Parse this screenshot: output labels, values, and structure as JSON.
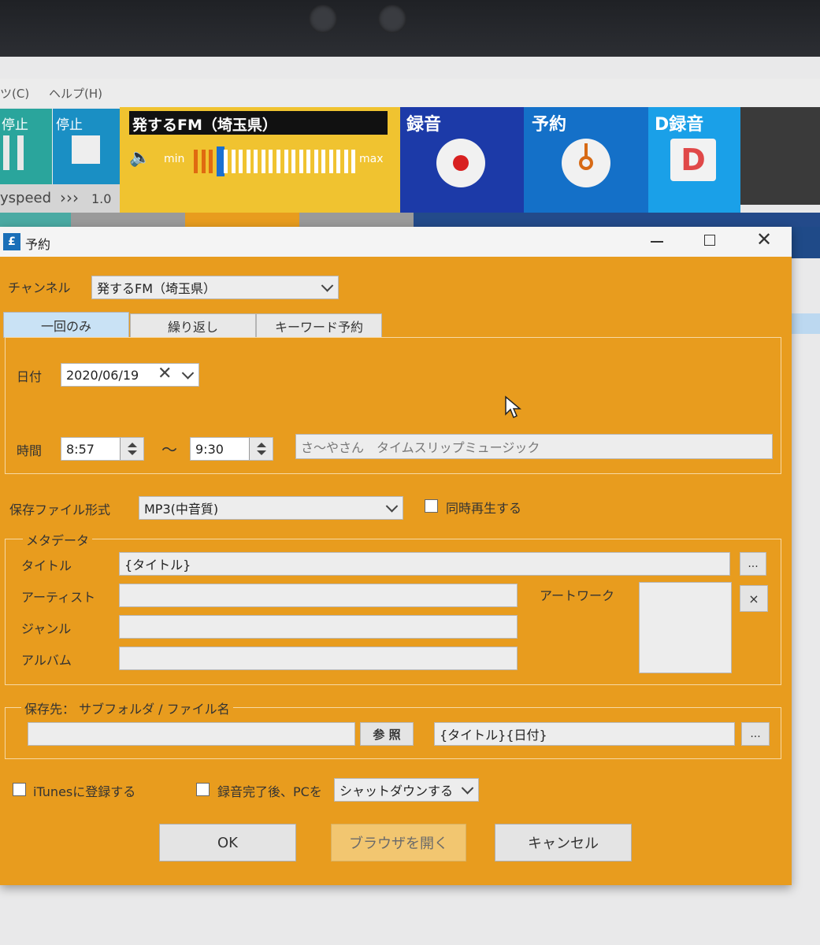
{
  "menu": {
    "items": [
      "ツ(C)",
      "ヘルプ(H)"
    ]
  },
  "player": {
    "pause_label": "停止",
    "stop_label": "停止",
    "speed_label": "yspeed",
    "speed_arrows": "›››",
    "speed_value": "1.0",
    "station": "発するFM（埼玉県）",
    "volume_min": "min",
    "volume_max": "max",
    "volume_level": 0.12,
    "record_label": "録音",
    "reserve_label": "予約",
    "drecord_label": "D録音",
    "drecord_glyph": "D"
  },
  "dialog": {
    "title": "予約",
    "channel": {
      "label": "チャンネル",
      "value": "発するFM（埼玉県）"
    },
    "tabs": [
      "一回のみ",
      "繰り返し",
      "キーワード予約"
    ],
    "date": {
      "label": "日付",
      "value": "2020/06/19"
    },
    "time": {
      "label": "時間",
      "start": "8:57",
      "separator": "～",
      "end": "9:30",
      "program": "さ～やさん　タイムスリップミュージック"
    },
    "format": {
      "label": "保存ファイル形式",
      "value": "MP3(中音質)",
      "simultaneous_label": "同時再生する"
    },
    "metadata": {
      "legend": "メタデータ",
      "title_label": "タイトル",
      "title_value": "{タイトル}",
      "artist_label": "アーティスト",
      "artist_value": "",
      "genre_label": "ジャンル",
      "genre_value": "",
      "album_label": "アルバム",
      "album_value": "",
      "artwork_label": "アートワーク",
      "browse_label": "...",
      "clear_label": "×"
    },
    "save": {
      "legend": "保存先：  サブフォルダ / ファイル名",
      "folder_value": "",
      "browse_label": "参 照",
      "filename_value": "{タイトル}{日付}",
      "more_label": "..."
    },
    "itunes_label": "iTunesに登録する",
    "after_label": "録音完了後、PCを",
    "after_value": "シャットダウンする",
    "buttons": {
      "ok": "OK",
      "browser": "ブラウザを開く",
      "cancel": "キャンセル"
    }
  }
}
